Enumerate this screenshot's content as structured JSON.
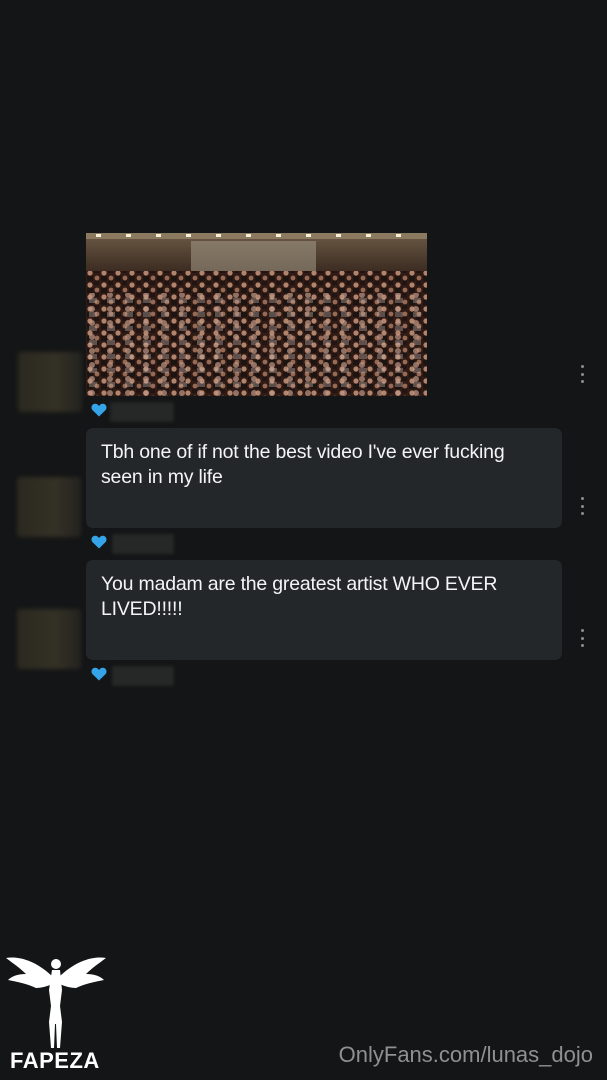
{
  "messages": [
    {
      "type": "image",
      "alt": "",
      "liked": true
    },
    {
      "type": "text",
      "text": "Tbh one of if not the best video I've ever fucking seen in my life",
      "liked": true
    },
    {
      "type": "text",
      "text": "You madam are the greatest artist WHO EVER LIVED!!!!!",
      "liked": true
    }
  ],
  "watermark": {
    "url_text": "OnlyFans.com/lunas_dojo",
    "brand": "FAPEZA"
  },
  "colors": {
    "background": "#141516",
    "bubble": "#24272a",
    "heart": "#35a3e8",
    "text": "#f3f4f5"
  },
  "icons": [
    "heart-icon",
    "kebab-menu-icon",
    "angel-logo-icon"
  ]
}
